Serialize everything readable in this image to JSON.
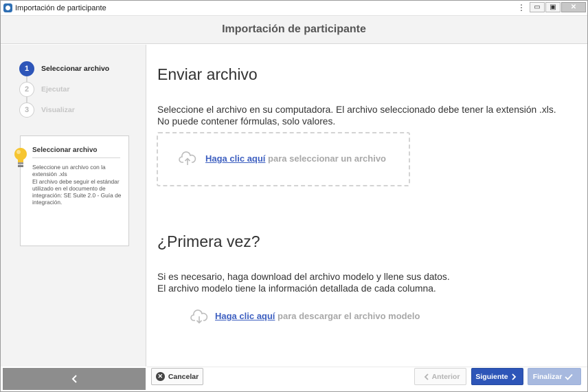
{
  "window": {
    "title": "Importación de participante",
    "menu_glyph": "⋮",
    "minimize_glyph": "▭",
    "maximize_glyph": "▣",
    "close_glyph": "✕"
  },
  "header": {
    "title": "Importación de participante"
  },
  "steps": [
    {
      "number": "1",
      "label": "Seleccionar archivo",
      "state": "active"
    },
    {
      "number": "2",
      "label": "Ejecutar",
      "state": "inactive"
    },
    {
      "number": "3",
      "label": "Visualizar",
      "state": "inactive"
    }
  ],
  "tip": {
    "title": "Seleccionar archivo",
    "body": "Seleccione un archivo con la extensión .xls\nEl archivo debe seguir el estándar utilizado en el documento de integración: SE Suite 2.0 - Guía de integración."
  },
  "upload_section": {
    "title": "Enviar archivo",
    "line1": "Seleccione el archivo en su computadora. El archivo seleccionado debe tener la extensión .xls.",
    "line2": "No puede contener fórmulas, solo valores.",
    "link": "Haga clic aquí",
    "link_suffix": " para seleccionar un archivo"
  },
  "first_time_section": {
    "title": "¿Primera vez?",
    "line1": "Si es necesario, haga download del archivo modelo y llene sus datos.",
    "line2": "El archivo modelo tiene la información detallada de cada columna.",
    "link": "Haga clic aquí",
    "link_suffix": " para descargar el archivo modelo"
  },
  "footer": {
    "cancel": "Cancelar",
    "previous": "Anterior",
    "next": "Siguiente",
    "finish": "Finalizar"
  },
  "colors": {
    "primary": "#2d55b8",
    "link": "#3d5fc0",
    "disabled_primary": "#a7b9df",
    "sidebar_bg": "#f3f3f3",
    "collapse_bar": "#8d8d8d"
  },
  "icons": {
    "app": "app-icon",
    "tip": "lightbulb-icon",
    "upload": "cloud-upload-icon",
    "download": "cloud-download-icon",
    "collapse": "chevron-left-icon",
    "cancel": "close-circle-icon",
    "previous": "chevron-left-icon",
    "next": "chevron-right-icon",
    "finish": "checkmark-icon"
  }
}
